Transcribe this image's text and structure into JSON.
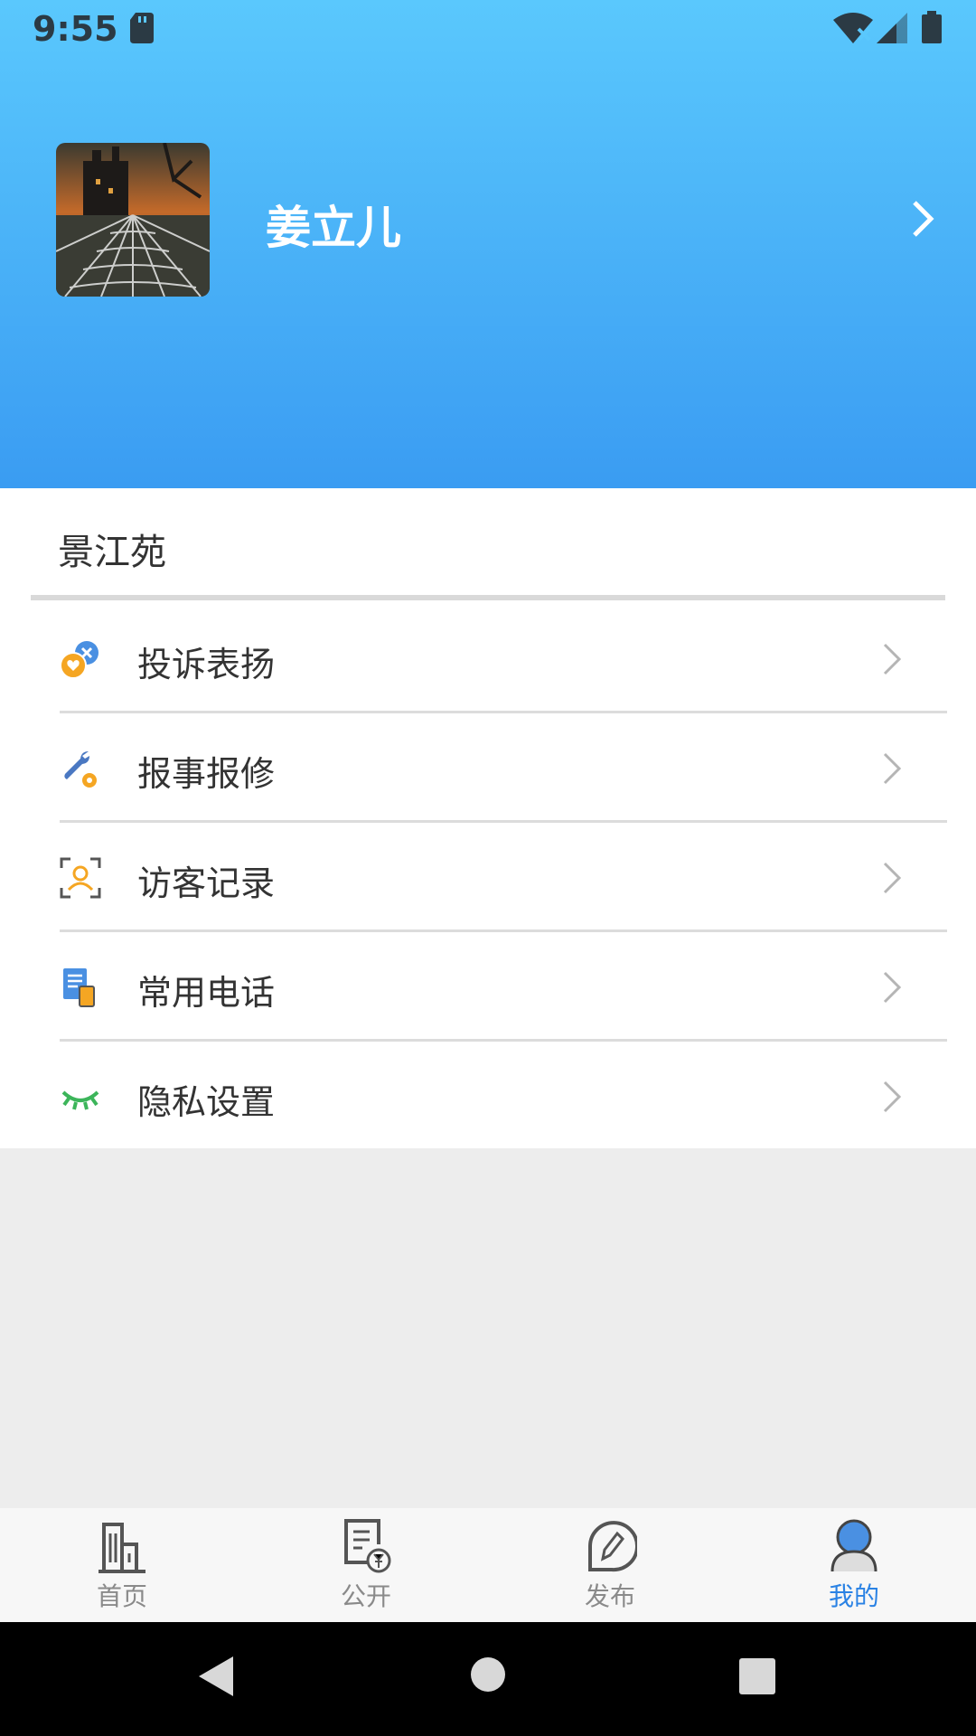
{
  "status_bar": {
    "time": "9:55"
  },
  "profile": {
    "name": "姜立儿"
  },
  "community": {
    "name": "景江苑"
  },
  "menu": [
    {
      "label": "投诉表扬",
      "icon": "complaint-praise-icon"
    },
    {
      "label": "报事报修",
      "icon": "repair-wrench-icon"
    },
    {
      "label": "访客记录",
      "icon": "visitor-scan-icon"
    },
    {
      "label": "常用电话",
      "icon": "phone-directory-icon"
    },
    {
      "label": "隐私设置",
      "icon": "closed-eye-icon"
    }
  ],
  "tabs": [
    {
      "label": "首页",
      "icon": "building-icon",
      "active": false
    },
    {
      "label": "公开",
      "icon": "document-yuan-icon",
      "active": false
    },
    {
      "label": "发布",
      "icon": "pen-bubble-icon",
      "active": false
    },
    {
      "label": "我的",
      "icon": "user-profile-icon",
      "active": true
    }
  ],
  "colors": {
    "header_top": "#5ac8fd",
    "header_bottom": "#3a9cf2",
    "active_tab": "#2a82e4"
  }
}
